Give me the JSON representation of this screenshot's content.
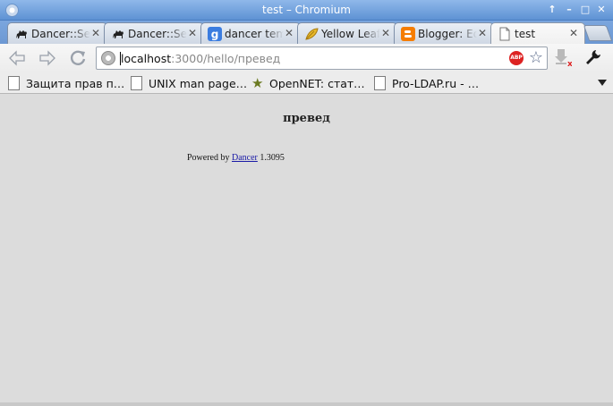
{
  "window": {
    "title": "test – Chromium",
    "controls": {
      "restore": "✦",
      "minimize": "–",
      "maximize": "□",
      "close": "✕"
    }
  },
  "tabs": [
    {
      "label": "Dancer::Session::Simple",
      "favicon": "camel-icon",
      "close": "✕",
      "active": false
    },
    {
      "label": "Dancer::Session::Simple",
      "favicon": "camel-icon",
      "close": "✕",
      "active": false
    },
    {
      "label": "dancer template",
      "favicon": "google-icon",
      "close": "✕",
      "active": false
    },
    {
      "label": "Yellow Leaf",
      "favicon": "yellow-leaf-icon",
      "close": "✕",
      "active": false
    },
    {
      "label": "Blogger: Edit",
      "favicon": "blogger-icon",
      "close": "✕",
      "active": false
    },
    {
      "label": "test",
      "favicon": "page-icon",
      "close": "✕",
      "active": true
    }
  ],
  "toolbar": {
    "url_host": "localhost",
    "url_rest": ":3000/hello/превед",
    "abp_label": "ABP"
  },
  "bookmarks": [
    {
      "label": "Защита прав п…",
      "icon": "page-icon"
    },
    {
      "label": "UNIX man page…",
      "icon": "page-icon"
    },
    {
      "label": "OpenNET: стат…",
      "icon": "star-icon"
    },
    {
      "label": "Pro-LDAP.ru - …",
      "icon": "page-icon"
    }
  ],
  "page": {
    "heading": "превед",
    "powered_prefix": "Powered by ",
    "powered_link": "Dancer",
    "powered_version": " 1.3095"
  },
  "colors": {
    "titlebar": "#6f9ddc",
    "content_bg": "#dcdcdc",
    "link": "#1a1aa6"
  }
}
